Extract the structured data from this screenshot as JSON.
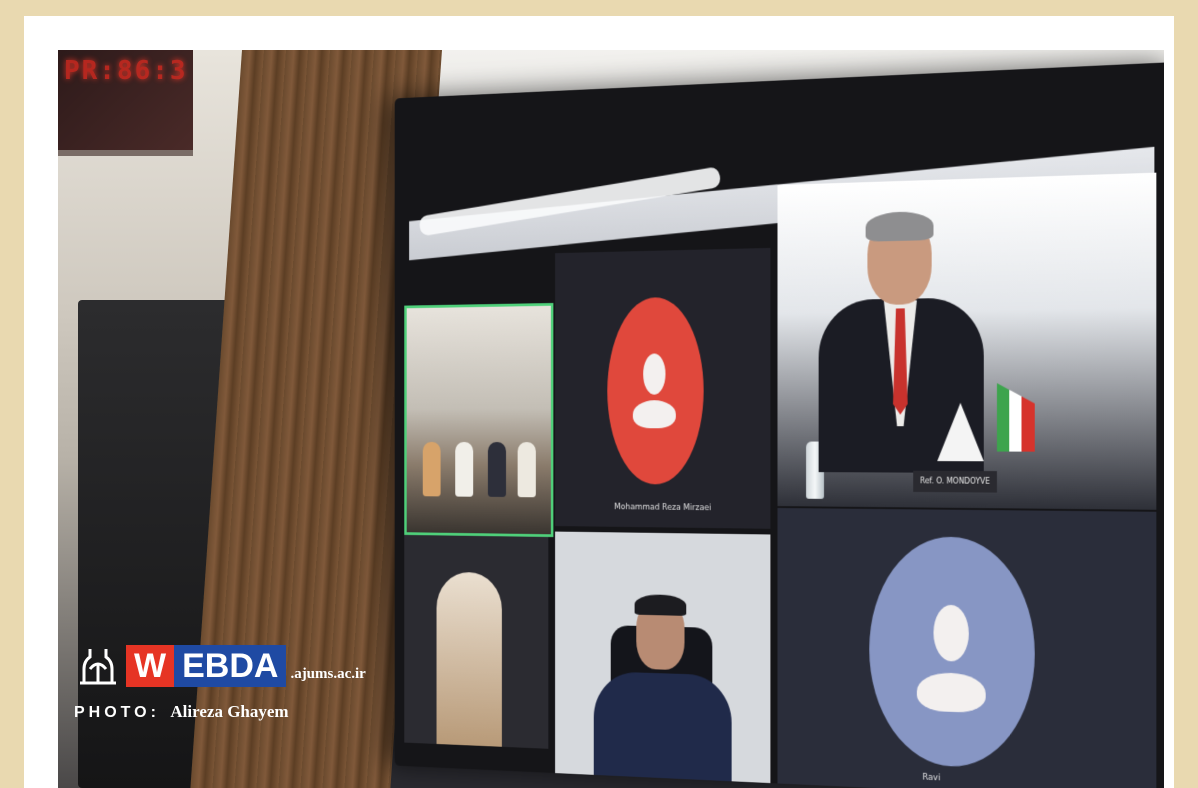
{
  "clock": {
    "digits": "PR:86:3"
  },
  "tiles": {
    "tile2_name": "Mohammad Reza Mirzaei",
    "tile3_placard": "Ref. O. MONDOYVE",
    "tile6_name": "Ravi"
  },
  "watermark": {
    "w": "W",
    "ebda": "EBDA",
    "domain": ".ajums.ac.ir",
    "credit_label": "PHOTO:",
    "credit_name": "Alireza Ghayem"
  },
  "colors": {
    "background": "#e9d9b0",
    "logo_red": "#e63424",
    "logo_blue": "#1f4aa3",
    "active_speaker": "#4fd07a",
    "avatar_red": "#e0483c",
    "avatar_blue": "#8796c4"
  }
}
